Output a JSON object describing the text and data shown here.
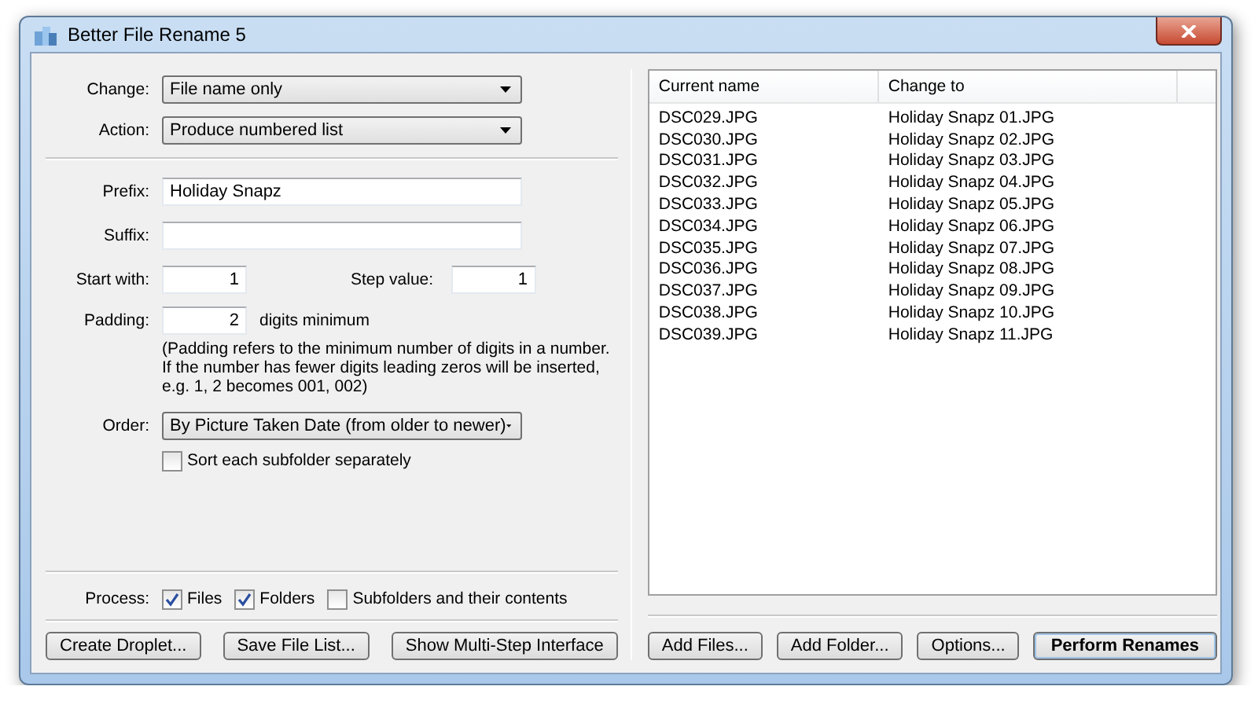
{
  "window": {
    "title": "Better File Rename 5"
  },
  "settings": {
    "change": {
      "label": "Change:",
      "value": "File name only"
    },
    "action": {
      "label": "Action:",
      "value": "Produce numbered list"
    },
    "prefix": {
      "label": "Prefix:",
      "value": "Holiday Snapz"
    },
    "suffix": {
      "label": "Suffix:"
    },
    "start_with": {
      "label": "Start with:",
      "value": "1"
    },
    "step_value": {
      "label": "Step value:",
      "value": "1"
    },
    "padding": {
      "label": "Padding:",
      "value": "2",
      "unit": "digits minimum"
    },
    "padding_note": [
      "(Padding refers to the minimum number of digits in a number.",
      "If the number has fewer digits leading zeros will be inserted,",
      "e.g. 1, 2 becomes 001, 002)"
    ],
    "order": {
      "label": "Order:",
      "value": "By Picture Taken Date (from older to newer)"
    },
    "sort_subfolders": {
      "label": "Sort each subfolder separately",
      "checked": false
    }
  },
  "process": {
    "label": "Process:",
    "options": [
      {
        "label": "Files",
        "checked": true
      },
      {
        "label": "Folders",
        "checked": true
      },
      {
        "label": "Subfolders and their contents",
        "checked": false
      }
    ]
  },
  "left_buttons": [
    "Create Droplet...",
    "Save File List...",
    "Show Multi-Step Interface"
  ],
  "file_list": {
    "columns": [
      "Current name",
      "Change to"
    ],
    "rows": [
      [
        "DSC029.JPG",
        "Holiday Snapz 01.JPG"
      ],
      [
        "DSC030.JPG",
        "Holiday Snapz 02.JPG"
      ],
      [
        "DSC031.JPG",
        "Holiday Snapz 03.JPG"
      ],
      [
        "DSC032.JPG",
        "Holiday Snapz 04.JPG"
      ],
      [
        "DSC033.JPG",
        "Holiday Snapz 05.JPG"
      ],
      [
        "DSC034.JPG",
        "Holiday Snapz 06.JPG"
      ],
      [
        "DSC035.JPG",
        "Holiday Snapz 07.JPG"
      ],
      [
        "DSC036.JPG",
        "Holiday Snapz 08.JPG"
      ],
      [
        "DSC037.JPG",
        "Holiday Snapz 09.JPG"
      ],
      [
        "DSC038.JPG",
        "Holiday Snapz 10.JPG"
      ],
      [
        "DSC039.JPG",
        "Holiday Snapz 11.JPG"
      ]
    ]
  },
  "right_buttons": [
    {
      "label": "Add Files...",
      "default": false
    },
    {
      "label": "Add Folder...",
      "default": false
    },
    {
      "label": "Options...",
      "default": false
    },
    {
      "label": "Perform Renames",
      "default": true
    }
  ]
}
